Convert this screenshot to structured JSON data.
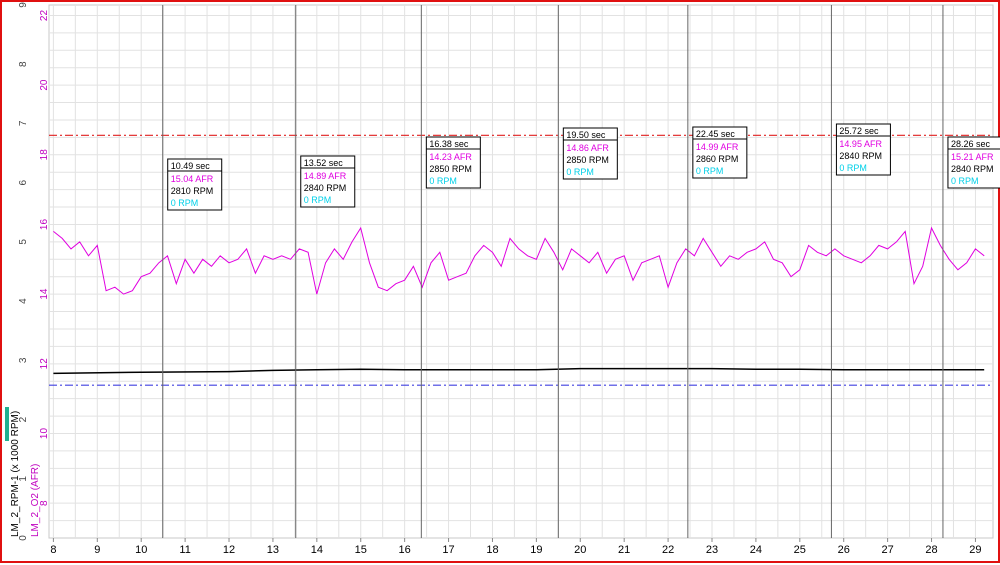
{
  "chart_data": {
    "type": "line",
    "title": "",
    "x_range": [
      7.9,
      29.4
    ],
    "x_ticks": [
      8,
      9,
      10,
      11,
      12,
      13,
      14,
      15,
      16,
      17,
      18,
      19,
      20,
      21,
      22,
      23,
      24,
      25,
      26,
      27,
      28,
      29
    ],
    "y_rpm_label": "LM_2_RPM-1 (x 1000 RPM)",
    "y_afr_label": "LM_2_O2 (AFR)",
    "y_rpm_range": [
      0,
      9
    ],
    "y_rpm_ticks": [
      0,
      1,
      2,
      3,
      4,
      5,
      6,
      7,
      8,
      9
    ],
    "y_afr_range": [
      7,
      22.3
    ],
    "y_afr_ticks": [
      8,
      10,
      12,
      14,
      16,
      18,
      20,
      22
    ],
    "grid": true,
    "series": [
      {
        "color": "#e000e0",
        "axis": "afr",
        "x": [
          8.0,
          8.2,
          8.4,
          8.6,
          8.8,
          9.0,
          9.2,
          9.4,
          9.6,
          9.8,
          10.0,
          10.2,
          10.4,
          10.6,
          10.8,
          11.0,
          11.2,
          11.4,
          11.6,
          11.8,
          12.0,
          12.2,
          12.4,
          12.6,
          12.8,
          13.0,
          13.2,
          13.4,
          13.6,
          13.8,
          14.0,
          14.2,
          14.4,
          14.6,
          14.8,
          15.0,
          15.2,
          15.4,
          15.6,
          15.8,
          16.0,
          16.2,
          16.4,
          16.6,
          16.8,
          17.0,
          17.2,
          17.4,
          17.6,
          17.8,
          18.0,
          18.2,
          18.4,
          18.6,
          18.8,
          19.0,
          19.2,
          19.4,
          19.6,
          19.8,
          20.0,
          20.2,
          20.4,
          20.6,
          20.8,
          21.0,
          21.2,
          21.4,
          21.6,
          21.8,
          22.0,
          22.2,
          22.4,
          22.6,
          22.8,
          23.0,
          23.2,
          23.4,
          23.6,
          23.8,
          24.0,
          24.2,
          24.4,
          24.6,
          24.8,
          25.0,
          25.2,
          25.4,
          25.6,
          25.8,
          26.0,
          26.2,
          26.4,
          26.6,
          26.8,
          27.0,
          27.2,
          27.4,
          27.6,
          27.8,
          28.0,
          28.2,
          28.4,
          28.6,
          28.8,
          29.0,
          29.2
        ],
        "y": [
          15.8,
          15.6,
          15.3,
          15.5,
          15.1,
          15.4,
          14.1,
          14.2,
          14.0,
          14.1,
          14.5,
          14.6,
          14.9,
          15.1,
          14.3,
          15.0,
          14.6,
          15.0,
          14.8,
          15.1,
          14.9,
          15.0,
          15.3,
          14.6,
          15.1,
          15.0,
          15.1,
          15.0,
          15.3,
          15.2,
          14.0,
          14.9,
          15.3,
          15.0,
          15.5,
          15.9,
          14.9,
          14.2,
          14.1,
          14.3,
          14.4,
          14.8,
          14.2,
          14.9,
          15.2,
          14.4,
          14.5,
          14.6,
          15.1,
          15.4,
          15.2,
          14.8,
          15.6,
          15.3,
          15.1,
          15.0,
          15.6,
          15.2,
          14.7,
          15.3,
          15.1,
          14.9,
          15.2,
          14.6,
          15.0,
          15.1,
          14.4,
          14.9,
          15.0,
          15.1,
          14.2,
          14.9,
          15.3,
          15.1,
          15.6,
          15.2,
          14.8,
          15.1,
          15.0,
          15.2,
          15.3,
          15.5,
          15.0,
          14.9,
          14.5,
          14.7,
          15.4,
          15.2,
          15.1,
          15.3,
          15.1,
          15.0,
          14.9,
          15.1,
          15.4,
          15.3,
          15.5,
          15.8,
          14.3,
          14.8,
          15.9,
          15.4,
          15.0,
          14.7,
          14.9,
          15.3,
          15.1
        ]
      },
      {
        "color": "#000000",
        "axis": "rpm",
        "x": [
          8.0,
          10.0,
          12.0,
          13.0,
          14.0,
          15.0,
          16.0,
          17.0,
          19.0,
          20.0,
          21.0,
          22.0,
          23.0,
          24.0,
          25.0,
          26.0,
          27.0,
          28.0,
          29.2
        ],
        "y": [
          2.78,
          2.8,
          2.81,
          2.83,
          2.84,
          2.85,
          2.84,
          2.84,
          2.84,
          2.86,
          2.86,
          2.86,
          2.86,
          2.85,
          2.85,
          2.84,
          2.84,
          2.84,
          2.84
        ]
      }
    ],
    "reference_lines": [
      {
        "axis": "afr",
        "y": 18.56,
        "color": "#e02020",
        "style": "dash-dot"
      },
      {
        "axis": "rpm",
        "y": 2.58,
        "color": "#4040e0",
        "style": "dash-dot"
      }
    ],
    "cursors": [
      {
        "x": 10.49,
        "time": "10.49 sec",
        "afr": "15.04 AFR",
        "rpm": "2810 RPM",
        "rpm2": "0 RPM"
      },
      {
        "x": 13.52,
        "time": "13.52 sec",
        "afr": "14.89 AFR",
        "rpm": "2840 RPM",
        "rpm2": "0 RPM"
      },
      {
        "x": 16.38,
        "time": "16.38 sec",
        "afr": "14.23 AFR",
        "rpm": "2850 RPM",
        "rpm2": "0 RPM"
      },
      {
        "x": 19.5,
        "time": "19.50 sec",
        "afr": "14.86 AFR",
        "rpm": "2850 RPM",
        "rpm2": "0 RPM"
      },
      {
        "x": 22.45,
        "time": "22.45 sec",
        "afr": "14.99 AFR",
        "rpm": "2860 RPM",
        "rpm2": "0 RPM"
      },
      {
        "x": 25.72,
        "time": "25.72 sec",
        "afr": "14.95 AFR",
        "rpm": "2840 RPM",
        "rpm2": "0 RPM"
      },
      {
        "x": 28.26,
        "time": "28.26 sec",
        "afr": "15.21 AFR",
        "rpm": "2840 RPM",
        "rpm2": "0 RPM"
      }
    ]
  }
}
